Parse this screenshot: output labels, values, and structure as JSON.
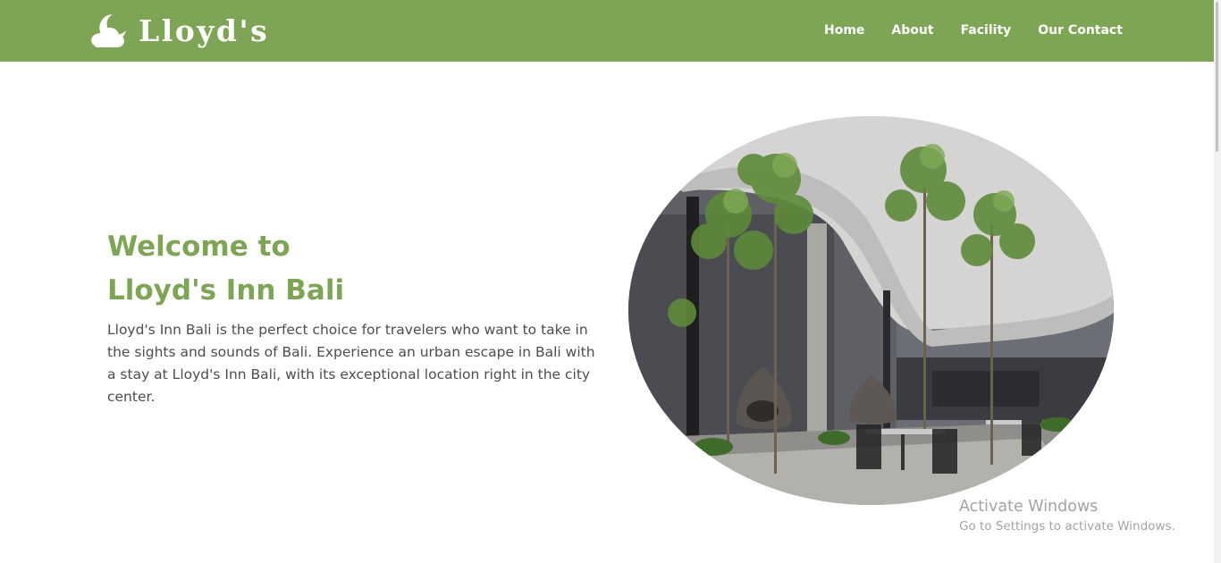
{
  "brand": {
    "name": "Lloyd's",
    "icon": "moon-cloud-icon",
    "color": "#7ea555"
  },
  "nav": {
    "items": [
      "Home",
      "About",
      "Facility",
      "Our Contact"
    ]
  },
  "hero": {
    "title_line1": "Welcome to",
    "title_line2": "Lloyd's Inn Bali",
    "description": "Lloyd's Inn Bali is the perfect choice for travelers who want to take in the sights and sounds of Bali. Experience an urban escape in Bali with a stay at Lloyd's Inn Bali, with its exceptional location right in the city center."
  },
  "watermark": {
    "title": "Activate Windows",
    "subtitle": "Go to Settings to activate Windows."
  }
}
